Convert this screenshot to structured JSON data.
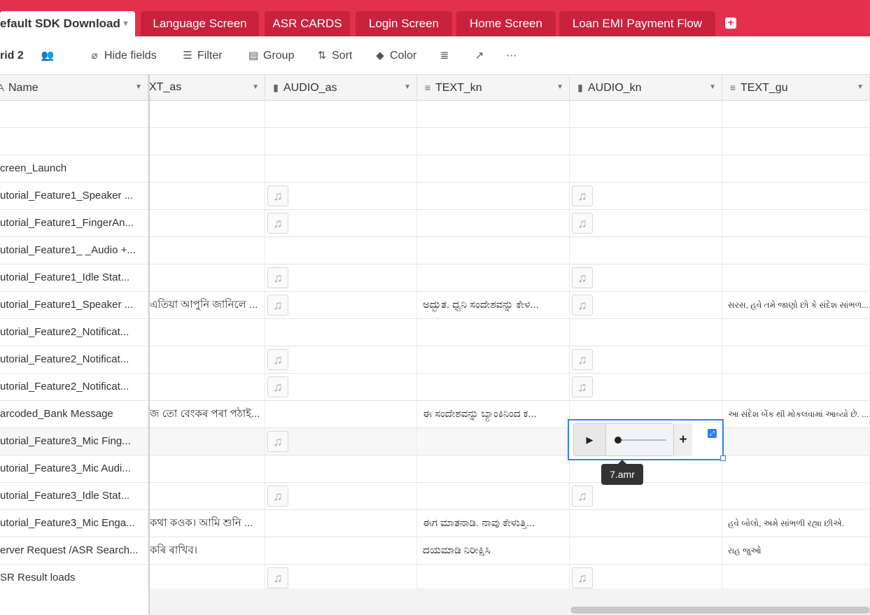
{
  "tabs": {
    "active": "efault SDK Download",
    "items": [
      "Language Screen",
      "ASR CARDS",
      "Login Screen",
      "Home Screen",
      "Loan EMI Payment Flow"
    ],
    "add_icon": "plus-square-icon"
  },
  "toolbar": {
    "view_name": "rid 2",
    "hide_fields": "Hide fields",
    "filter": "Filter",
    "group": "Group",
    "sort": "Sort",
    "color": "Color"
  },
  "columns": {
    "name": "Name",
    "text_as": "XT_as",
    "audio_as": "AUDIO_as",
    "text_kn": "TEXT_kn",
    "audio_kn": "AUDIO_kn",
    "text_gu": "TEXT_gu"
  },
  "rows": [
    {
      "name": "",
      "text_as": "",
      "audio_as": false,
      "text_kn": "",
      "audio_kn": false,
      "text_gu": ""
    },
    {
      "name": "",
      "text_as": "",
      "audio_as": false,
      "text_kn": "",
      "audio_kn": false,
      "text_gu": ""
    },
    {
      "name": "creen_Launch",
      "text_as": "",
      "audio_as": false,
      "text_kn": "",
      "audio_kn": false,
      "text_gu": ""
    },
    {
      "name": "utorial_Feature1_Speaker ...",
      "text_as": "",
      "audio_as": true,
      "text_kn": "",
      "audio_kn": true,
      "text_gu": ""
    },
    {
      "name": "utorial_Feature1_FingerAn...",
      "text_as": "",
      "audio_as": true,
      "text_kn": "",
      "audio_kn": true,
      "text_gu": ""
    },
    {
      "name": "utorial_Feature1_ _Audio +...",
      "text_as": "",
      "audio_as": false,
      "text_kn": "",
      "audio_kn": false,
      "text_gu": ""
    },
    {
      "name": "utorial_Feature1_Idle Stat...",
      "text_as": "",
      "audio_as": true,
      "text_kn": "",
      "audio_kn": true,
      "text_gu": ""
    },
    {
      "name": "utorial_Feature1_Speaker ...",
      "text_as": "এতিয়া আপুনি জানিলে ...",
      "audio_as": true,
      "text_kn": "ಅದ್ಭುತ. ಧ್ವನಿ ಸಂದೇಶವನ್ನು ಕೇಳ...",
      "audio_kn": true,
      "text_gu": "સરસ, હવે તમે જાણો છો કે સંદેશ સાંભળ..."
    },
    {
      "name": "utorial_Feature2_Notificat...",
      "text_as": "",
      "audio_as": false,
      "text_kn": "",
      "audio_kn": false,
      "text_gu": ""
    },
    {
      "name": "utorial_Feature2_Notificat...",
      "text_as": "",
      "audio_as": true,
      "text_kn": "",
      "audio_kn": true,
      "text_gu": ""
    },
    {
      "name": "utorial_Feature2_Notificat...",
      "text_as": "",
      "audio_as": true,
      "text_kn": "",
      "audio_kn": true,
      "text_gu": ""
    },
    {
      "name": "arcoded_Bank Message",
      "text_as": "জ তো বেংকৰ পৰা পঠাই...",
      "audio_as": false,
      "text_kn": "ಈ ಸಂದೇಶವನ್ನು ಬ್ಯಾಂಕಿನಿಂದ ಕ...",
      "audio_kn": false,
      "text_gu": "આ સંદેશ બેંક થી મોકલવામાં આવ્યો છે. ..."
    },
    {
      "name": "utorial_Feature3_Mic Fing...",
      "text_as": "",
      "audio_as": true,
      "text_kn": "",
      "audio_kn": false,
      "text_gu": ""
    },
    {
      "name": "utorial_Feature3_Mic Audi...",
      "text_as": "",
      "audio_as": false,
      "text_kn": "",
      "audio_kn": false,
      "text_gu": ""
    },
    {
      "name": "utorial_Feature3_Idle Stat...",
      "text_as": "",
      "audio_as": true,
      "text_kn": "",
      "audio_kn": true,
      "text_gu": ""
    },
    {
      "name": "utorial_Feature3_Mic Enga...",
      "text_as": "কথা কওক। আমি শুনি ...",
      "audio_as": false,
      "text_kn": "ಈಗ ಮಾತನಾಡಿ. ನಾವು ಕೇಳುತ್ತಿ...",
      "audio_kn": false,
      "text_gu": "હવે બોલો, અમે સાંભળી રહ્યા છીએ."
    },
    {
      "name": "erver Request /ASR Search...",
      "text_as": "কৰি ৰাখিব।",
      "audio_as": false,
      "text_kn": "ದಯಮಾಡಿ ನಿರೀಕ್ಷಿಸಿ",
      "audio_kn": false,
      "text_gu": "રાહ જુઓ"
    },
    {
      "name": "SR Result loads",
      "text_as": "",
      "audio_as": true,
      "text_kn": "",
      "audio_kn": true,
      "text_gu": ""
    }
  ],
  "player": {
    "tooltip": "7.amr",
    "play_icon": "play-icon",
    "add_icon": "plus-icon",
    "expand_icon": "expand-icon"
  }
}
